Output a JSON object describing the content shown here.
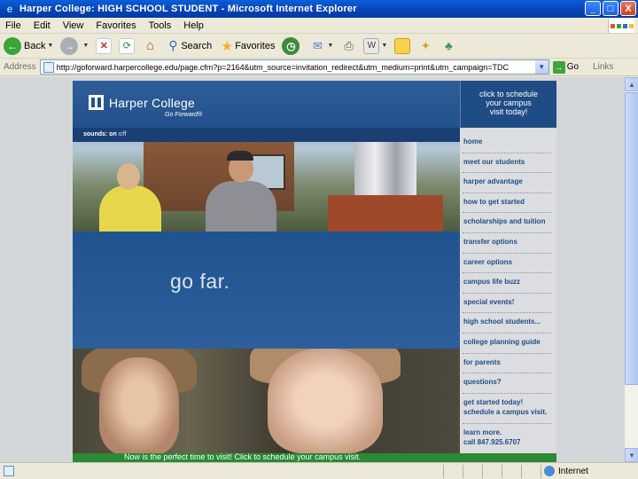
{
  "window": {
    "title": "Harper College: HIGH SCHOOL STUDENT - Microsoft Internet Explorer",
    "buttons": [
      "_",
      "□",
      "X"
    ]
  },
  "menu": [
    "File",
    "Edit",
    "View",
    "Favorites",
    "Tools",
    "Help"
  ],
  "toolbar": {
    "back_label": "Back",
    "search_label": "Search",
    "favorites_label": "Favorites"
  },
  "address_bar": {
    "label": "Address",
    "url": "http://goforward.harpercollege.edu/page.cfm?p=2164&utm_source=invitation_redirect&utm_medium=print&utm_campaign=TDC",
    "go_label": "Go",
    "links_label": "Links"
  },
  "site": {
    "brand_name": "Harper College",
    "tagline": "Go Forward®",
    "cta": [
      "click to schedule",
      "your campus",
      "visit today!"
    ],
    "sound_label": "sounds: on",
    "sound_off": "off",
    "hero_text": "go far.",
    "footer_banner": "Now is the perfect time to visit! Click to schedule your campus visit.",
    "nav": [
      "home",
      "meet our students",
      "harper advantage",
      "how to get started",
      "scholarships and tuition",
      "transfer options",
      "career options",
      "campus life buzz",
      "special events!",
      "high school students...",
      "college planning guide",
      "for parents",
      "questions?"
    ],
    "nav_get_started": [
      "get started today!",
      "schedule a campus visit."
    ],
    "nav_learn_more": [
      "learn more.",
      "call 847.925.6707"
    ]
  },
  "status_bar": {
    "zone": "Internet"
  },
  "colors": {
    "harper_blue": "#23508c",
    "nav_text": "#1f4c85",
    "banner_green": "#2a8a35"
  }
}
